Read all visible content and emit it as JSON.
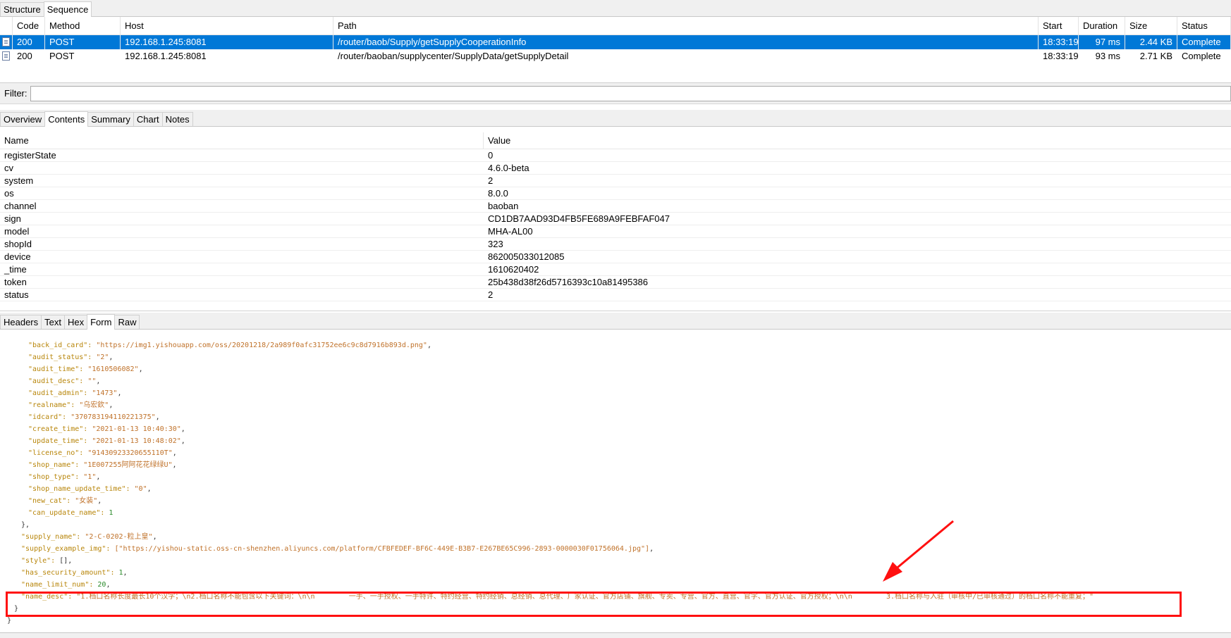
{
  "top_tabs": [
    "Structure",
    "Sequence"
  ],
  "top_tab_active": "Sequence",
  "sequence": {
    "columns": [
      "Code",
      "Method",
      "Host",
      "Path",
      "Start",
      "Duration",
      "Size",
      "Status"
    ],
    "rows": [
      {
        "code": "200",
        "method": "POST",
        "host": "192.168.1.245:8081",
        "path": "/router/baob/Supply/getSupplyCooperationInfo",
        "start": "18:33:19",
        "duration": "97 ms",
        "size": "2.44 KB",
        "status": "Complete",
        "selected": true
      },
      {
        "code": "200",
        "method": "POST",
        "host": "192.168.1.245:8081",
        "path": "/router/baoban/supplycenter/SupplyData/getSupplyDetail",
        "start": "18:33:19",
        "duration": "93 ms",
        "size": "2.71 KB",
        "status": "Complete",
        "selected": false
      }
    ]
  },
  "filter": {
    "label": "Filter:",
    "value": ""
  },
  "detail_tabs": [
    "Overview",
    "Contents",
    "Summary",
    "Chart",
    "Notes"
  ],
  "detail_tab_active": "Contents",
  "form_table": {
    "columns": [
      "Name",
      "Value"
    ],
    "rows": [
      {
        "name": "registerState",
        "value": "0"
      },
      {
        "name": "cv",
        "value": "4.6.0-beta"
      },
      {
        "name": "system",
        "value": "2"
      },
      {
        "name": "os",
        "value": "8.0.0"
      },
      {
        "name": "channel",
        "value": "baoban"
      },
      {
        "name": "sign",
        "value": "CD1DB7AAD93D4FB5FE689A9FEBFAF047"
      },
      {
        "name": "model",
        "value": "MHA-AL00"
      },
      {
        "name": "shopId",
        "value": "323"
      },
      {
        "name": "device",
        "value": "862005033012085"
      },
      {
        "name": "_time",
        "value": "1610620402"
      },
      {
        "name": "token",
        "value": "25b438d38f26d5716393c10a81495386"
      },
      {
        "name": "status",
        "value": "2"
      }
    ]
  },
  "sub_tabs": [
    "Headers",
    "Text",
    "Hex",
    "Form",
    "Raw"
  ],
  "sub_tab_active": "Form",
  "json_lines": [
    {
      "indent": 6,
      "key": "back_id_card",
      "val": "\"https://img1.yishouapp.com/oss/20201218/2a989f0afc31752ee6c9c8d7916b893d.png\"",
      "kind": "s",
      "trail": ","
    },
    {
      "indent": 6,
      "key": "audit_status",
      "val": "\"2\"",
      "kind": "s",
      "trail": ","
    },
    {
      "indent": 6,
      "key": "audit_time",
      "val": "\"1610506082\"",
      "kind": "s",
      "trail": ","
    },
    {
      "indent": 6,
      "key": "audit_desc",
      "val": "\"\"",
      "kind": "s",
      "trail": ","
    },
    {
      "indent": 6,
      "key": "audit_admin",
      "val": "\"1473\"",
      "kind": "s",
      "trail": ","
    },
    {
      "indent": 6,
      "key": "realname",
      "val": "\"乌宏欽\"",
      "kind": "s",
      "trail": ","
    },
    {
      "indent": 6,
      "key": "idcard",
      "val": "\"370783194110221375\"",
      "kind": "s",
      "trail": ","
    },
    {
      "indent": 6,
      "key": "create_time",
      "val": "\"2021-01-13 10:40:30\"",
      "kind": "s",
      "trail": ","
    },
    {
      "indent": 6,
      "key": "update_time",
      "val": "\"2021-01-13 10:48:02\"",
      "kind": "s",
      "trail": ","
    },
    {
      "indent": 6,
      "key": "license_no",
      "val": "\"91430923320655110T\"",
      "kind": "s",
      "trail": ","
    },
    {
      "indent": 6,
      "key": "shop_name",
      "val": "\"1E007255阿阿花花绿绿U\"",
      "kind": "s",
      "trail": ","
    },
    {
      "indent": 6,
      "key": "shop_type",
      "val": "\"1\"",
      "kind": "s",
      "trail": ","
    },
    {
      "indent": 6,
      "key": "shop_name_update_time",
      "val": "\"0\"",
      "kind": "s",
      "trail": ","
    },
    {
      "indent": 6,
      "key": "new_cat",
      "val": "\"女装\"",
      "kind": "s",
      "trail": ","
    },
    {
      "indent": 6,
      "key": "can_update_name",
      "val": "1",
      "kind": "n",
      "trail": ""
    },
    {
      "indent": 4,
      "raw": "},"
    },
    {
      "indent": 4,
      "key": "supply_name",
      "val": "\"2-C-0202-粒上皇\"",
      "kind": "s",
      "trail": ","
    },
    {
      "indent": 4,
      "key": "supply_example_img",
      "val": "[\"https://yishou-static.oss-cn-shenzhen.aliyuncs.com/platform/CFBFEDEF-BF6C-449E-B3B7-E267BE65C996-2893-0000030F01756064.jpg\"]",
      "kind": "s",
      "trail": ","
    },
    {
      "indent": 4,
      "key": "style",
      "val": "[]",
      "kind": "p",
      "trail": ","
    },
    {
      "indent": 4,
      "key": "has_security_amount",
      "val": "1",
      "kind": "n",
      "trail": ","
    },
    {
      "indent": 4,
      "key": "name_limit_num",
      "val": "20",
      "kind": "n",
      "trail": ","
    },
    {
      "indent": 4,
      "key": "name_desc",
      "val": "\"1.档口名称长度最长10个汉字；\\n2.档口名称不能包含以下关键词：\\n\\n        一手、一手授权、一手特许、特约经营、特约经销、总经销、总代理、厂家认证、官方店铺、旗舰、专卖、专营、官方、直营、官字、官方认证、官方授权；\\n\\n        3.档口名称与入驻（审核中/已审核通过）的档口名称不能重复；\"",
      "kind": "s",
      "trail": ""
    },
    {
      "indent": 2,
      "raw": "}"
    },
    {
      "indent": 0,
      "raw": "}"
    }
  ],
  "colors": {
    "selection": "#0078d7",
    "highlight": "#ff1010",
    "arrow": "#ff1010"
  },
  "icons": [
    "file-icon"
  ]
}
